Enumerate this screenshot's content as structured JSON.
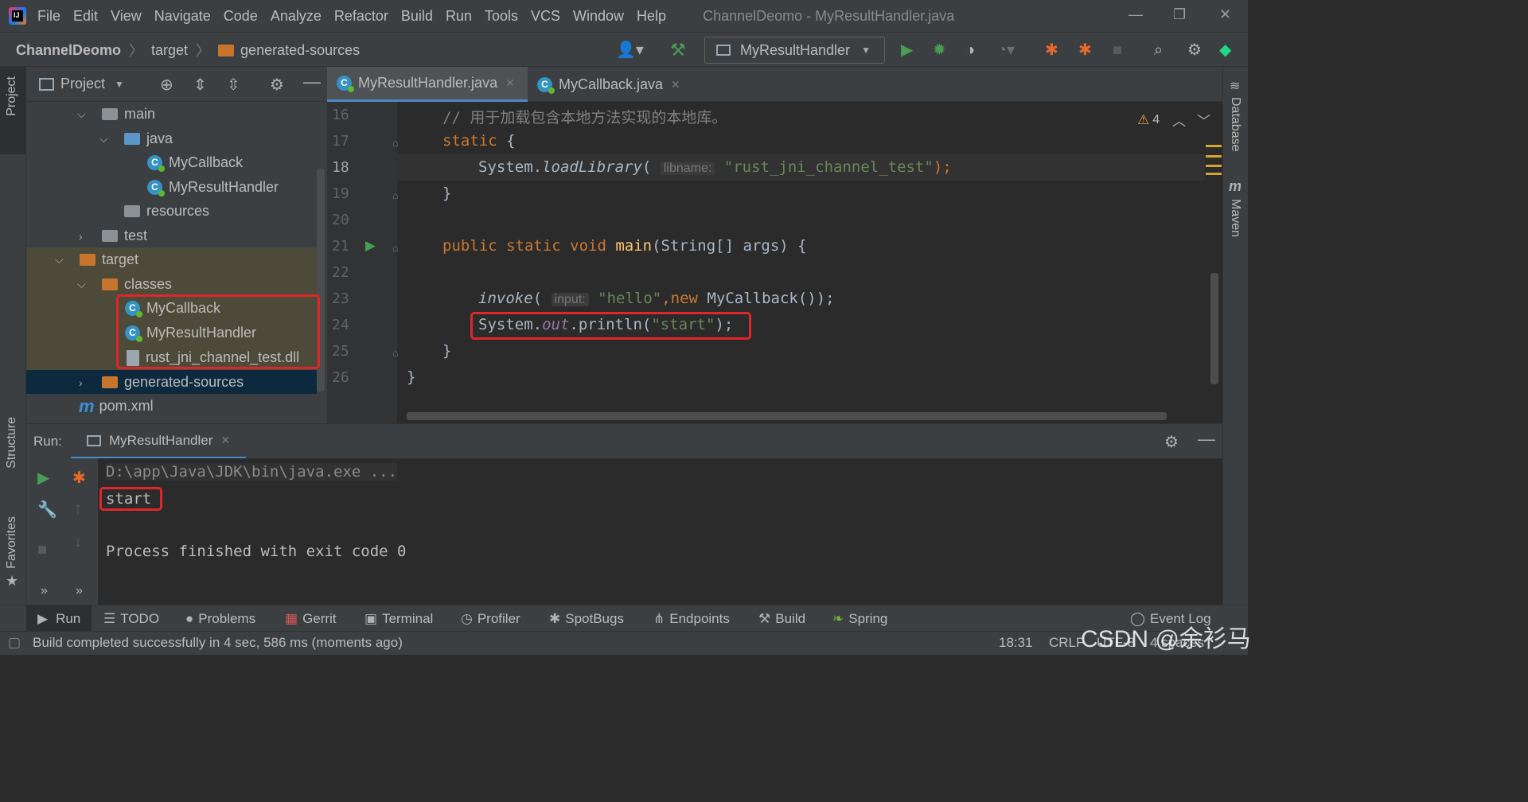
{
  "menu": {
    "items": [
      "File",
      "Edit",
      "View",
      "Navigate",
      "Code",
      "Analyze",
      "Refactor",
      "Build",
      "Run",
      "Tools",
      "VCS",
      "Window",
      "Help"
    ],
    "window_title": "ChannelDeomo - MyResultHandler.java"
  },
  "breadcrumb": {
    "project": "ChannelDeomo",
    "target": "target",
    "generated": "generated-sources"
  },
  "toolbar": {
    "run_config": "MyResultHandler"
  },
  "left_strip": {
    "project": "Project",
    "structure": "Structure",
    "favorites": "Favorites"
  },
  "right_strip": {
    "database": "Database",
    "maven": "Maven"
  },
  "project_panel": {
    "title": "Project",
    "tree": [
      {
        "label": "main"
      },
      {
        "label": "java"
      },
      {
        "label": "MyCallback"
      },
      {
        "label": "MyResultHandler"
      },
      {
        "label": "resources"
      },
      {
        "label": "test"
      },
      {
        "label": "target"
      },
      {
        "label": "classes"
      },
      {
        "label": "MyCallback"
      },
      {
        "label": "MyResultHandler"
      },
      {
        "label": "rust_jni_channel_test.dll"
      },
      {
        "label": "generated-sources"
      },
      {
        "label": "pom.xml"
      }
    ]
  },
  "editor": {
    "tabs": [
      "MyResultHandler.java",
      "MyCallback.java"
    ],
    "warnings": "4",
    "line_numbers": [
      "16",
      "17",
      "18",
      "19",
      "20",
      "21",
      "22",
      "23",
      "24",
      "25",
      "26"
    ],
    "code": {
      "l16": "// 用于加载包含本地方法实现的本地库。",
      "l17_kw": "static",
      "l17_rest": " {",
      "l18_pre": "System.",
      "l18_fn": "loadLibrary",
      "l18_paren": "(",
      "l18_hint": "libname:",
      "l18_str": "\"rust_jni_channel_test\"",
      "l18_end": ");",
      "l19": "}",
      "l21_kw": "public static void ",
      "l21_fn": "main",
      "l21_rest": "(String[] args) {",
      "l23_fn": "invoke",
      "l23_paren": "(",
      "l23_hint": "input:",
      "l23_str": "\"hello\"",
      "l23_comma": ",",
      "l23_kw": "new ",
      "l23_rest": "MyCallback());",
      "l24_pre": "System.",
      "l24_field": "out",
      "l24_mid": ".println(",
      "l24_str": "\"start\"",
      "l24_end": ");",
      "l25": "}",
      "l26": "}"
    }
  },
  "run": {
    "label": "Run:",
    "tab": "MyResultHandler",
    "console": [
      "D:\\app\\Java\\JDK\\bin\\java.exe ...",
      "start",
      "Process finished with exit code 0"
    ]
  },
  "tool_windows": [
    "Run",
    "TODO",
    "Problems",
    "Gerrit",
    "Terminal",
    "Profiler",
    "SpotBugs",
    "Endpoints",
    "Build",
    "Spring",
    "Event Log"
  ],
  "status": {
    "message": "Build completed successfully in 4 sec, 586 ms (moments ago)",
    "position": "18:31",
    "line_sep": "CRLF",
    "encoding": "UTF-8",
    "indent": "4 spaces",
    "watermark": "CSDN @余衫马"
  },
  "colors": {
    "accent": "#4a88c7",
    "highlight": "#e0262a",
    "run_green": "#499c54"
  }
}
